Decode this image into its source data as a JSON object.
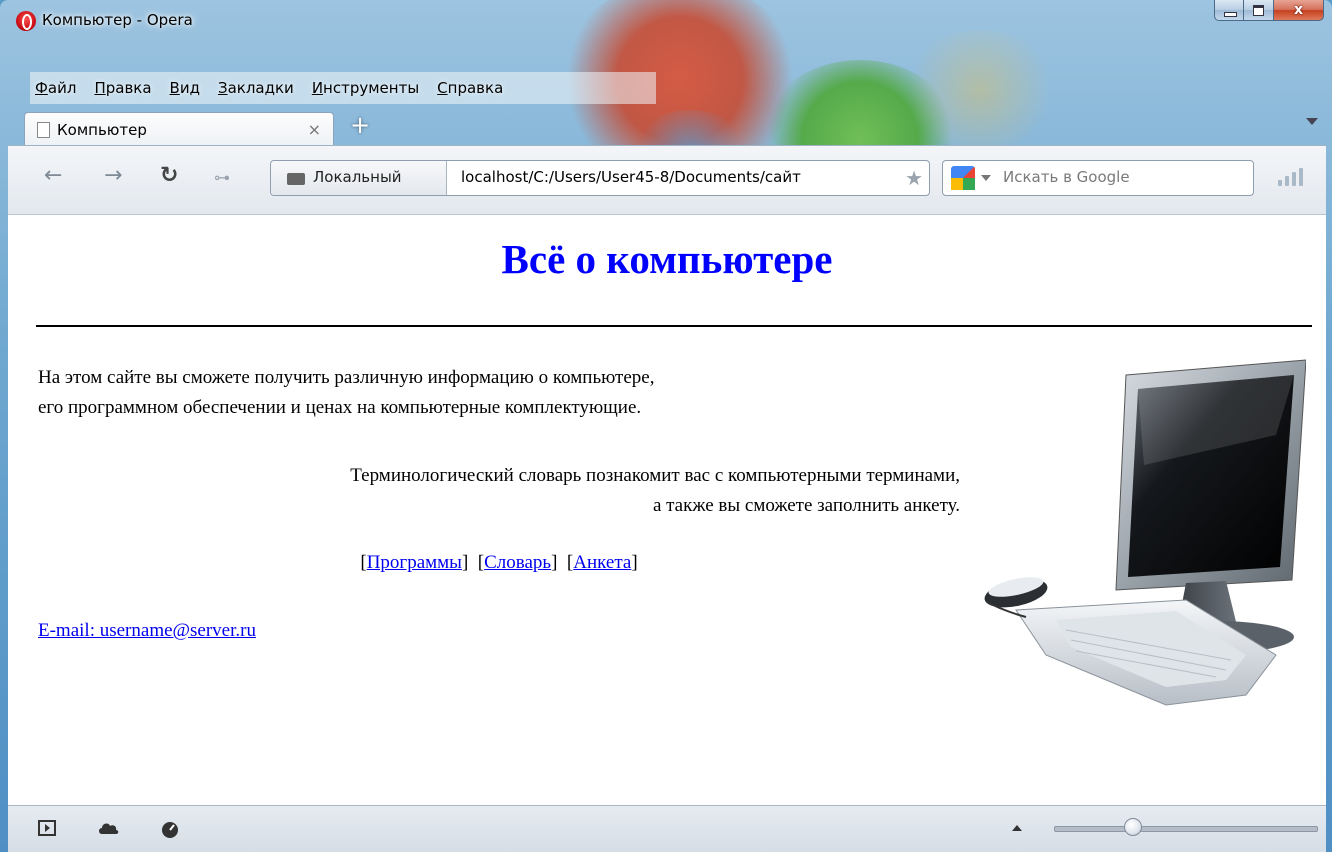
{
  "window": {
    "title": "Компьютер - Opera",
    "close_glyph": "x"
  },
  "menubar": {
    "items": [
      {
        "hotkey": "Ф",
        "rest": "айл"
      },
      {
        "hotkey": "П",
        "rest": "равка"
      },
      {
        "hotkey": "В",
        "rest": "ид"
      },
      {
        "hotkey": "З",
        "rest": "акладки"
      },
      {
        "hotkey": "И",
        "rest": "нструменты"
      },
      {
        "hotkey": "С",
        "rest": "правка"
      }
    ]
  },
  "tabs": {
    "active_label": "Компьютер",
    "close_glyph": "×",
    "new_tab_glyph": "+"
  },
  "toolbar": {
    "back_icon": "←",
    "forward_icon": "→",
    "reload_icon": "↻",
    "key_icon": "⊶",
    "address_badge": "Локальный",
    "address_url": "localhost/C:/Users/User45-8/Documents/сайт",
    "star_icon": "★",
    "search_placeholder": "Искать в Google"
  },
  "page": {
    "heading": "Всё о компьютере",
    "paragraph1_line1": "На этом сайте вы сможете получить различную информацию о компьютере,",
    "paragraph1_line2": "его программном обеспечении и ценах на компьютерные комплектующие.",
    "paragraph2_line1": "Терминологический словарь познакомит вас с компьютерными терминами,",
    "paragraph2_line2": "а также вы сможете заполнить анкету.",
    "links": [
      {
        "label": "Программы"
      },
      {
        "label": "Словарь"
      },
      {
        "label": "Анкета"
      }
    ],
    "email": "E-mail: username@server.ru"
  },
  "statusbar": {
    "zoom_fraction": 0.3
  }
}
